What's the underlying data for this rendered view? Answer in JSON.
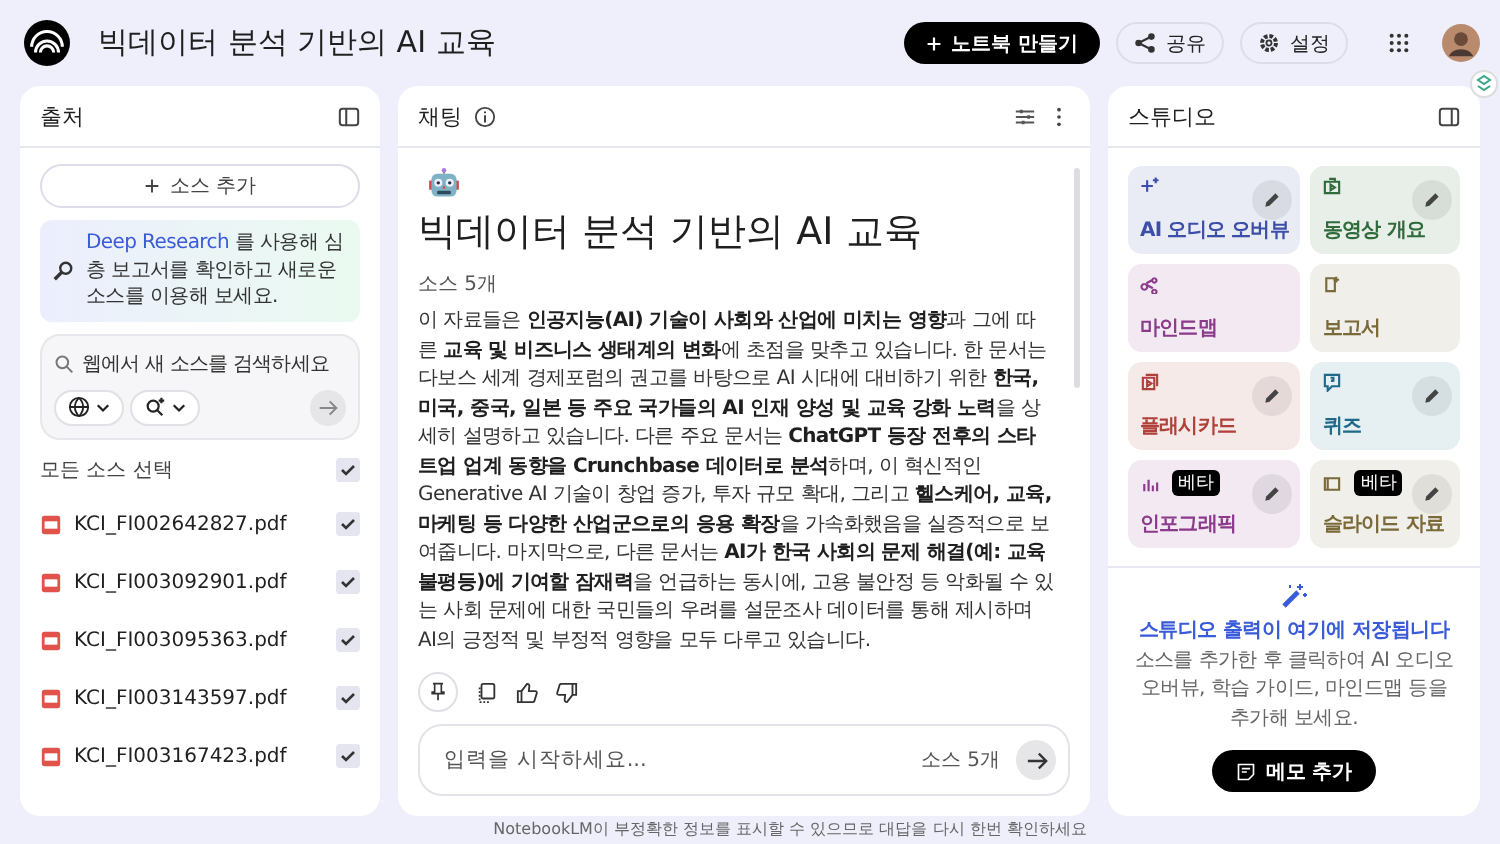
{
  "app": {
    "title": "빅데이터 분석 기반의 AI 교육",
    "buttons": [
      {
        "label": "노트북 만들기",
        "kind": "primary"
      },
      {
        "label": "공유",
        "kind": "share"
      },
      {
        "label": "설정",
        "kind": "settings"
      }
    ]
  },
  "sources": {
    "title": "출처",
    "add_button": "소스 추가",
    "banner": {
      "link": "Deep Research",
      "text": "를 사용해 심층 보고서를 확인하고 새로운 소스를 이용해 보세요."
    },
    "search": {
      "placeholder": "웹에서 새 소스를 검색하세요"
    },
    "select_all": {
      "label": "모든 소스 선택",
      "checked": true
    },
    "items": [
      {
        "name": "KCI_FI002642827.pdf",
        "checked": true
      },
      {
        "name": "KCI_FI003092901.pdf",
        "checked": true
      },
      {
        "name": "KCI_FI003095363.pdf",
        "checked": true
      },
      {
        "name": "KCI_FI003143597.pdf",
        "checked": true
      },
      {
        "name": "KCI_FI003167423.pdf",
        "checked": true
      }
    ]
  },
  "chat": {
    "title": "채팅",
    "heading": "빅데이터 분석 기반의 AI 교육",
    "source_count": "소스 5개",
    "summary": "이 자료들은 **인공지능(AI) 기술이 사회와 산업에 미치는 영향**과 그에 따른 **교육 및 비즈니스 생태계의 변화**에 초점을 맞추고 있습니다. 한 문서는 다보스 세계 경제포럼의 권고를 바탕으로 AI 시대에 대비하기 위한 **한국, 미국, 중국, 일본 등 주요 국가들의 AI 인재 양성 및 교육 강화 노력**을 상세히 설명하고 있습니다. 다른 주요 문서는 **ChatGPT 등장 전후의 스타트업 업계 동향을 Crunchbase 데이터로 분석**하며, 이 혁신적인 Generative AI 기술이 창업 증가, 투자 규모 확대, 그리고 **헬스케어, 교육, 마케팅 등 다양한 산업군으로의 응용 확장**을 가속화했음을 실증적으로 보여줍니다. 마지막으로, 다른 문서는 **AI가 한국 사회의 문제 해결(예: 교육 불평등)에 기여할 잠재력**을 언급하는 동시에, 고용 불안정 등 악화될 수 있는 사회 문제에 대한 국민들의 우려를 설문조사 데이터를 통해 제시하며 AI의 긍정적 및 부정적 영향을 모두 다루고 있습니다.",
    "input": {
      "placeholder": "입력을 시작하세요...",
      "source_count": "소스 5개"
    }
  },
  "studio": {
    "title": "스튜디오",
    "tiles": [
      {
        "label": "AI 오디오 오버뷰",
        "color": "#3d4ea8",
        "editable": true
      },
      {
        "label": "동영상 개요",
        "color": "#2f6b3b",
        "editable": true
      },
      {
        "label": "마인드맵",
        "color": "#8c3a8c",
        "editable": false
      },
      {
        "label": "보고서",
        "color": "#7a6a3a",
        "editable": false
      },
      {
        "label": "플래시카드",
        "color": "#b0403a",
        "editable": true
      },
      {
        "label": "퀴즈",
        "color": "#1f6a88",
        "editable": true
      },
      {
        "label": "인포그래픽",
        "color": "#8c3a8c",
        "editable": true,
        "badge": "베타"
      },
      {
        "label": "슬라이드 자료",
        "color": "#7a6a3a",
        "editable": true,
        "badge": "베타"
      }
    ],
    "empty": {
      "title": "스튜디오 출력이 여기에 저장됩니다",
      "text": "소스를 추가한 후 클릭하여 AI 오디오 오버뷰, 학습 가이드, 마인드맵 등을 추가해 보세요."
    },
    "note_button": "메모 추가"
  },
  "footer": "NotebookLM이 부정확한 정보를 표시할 수 있으므로 대답을 다시 한번 확인하세요"
}
